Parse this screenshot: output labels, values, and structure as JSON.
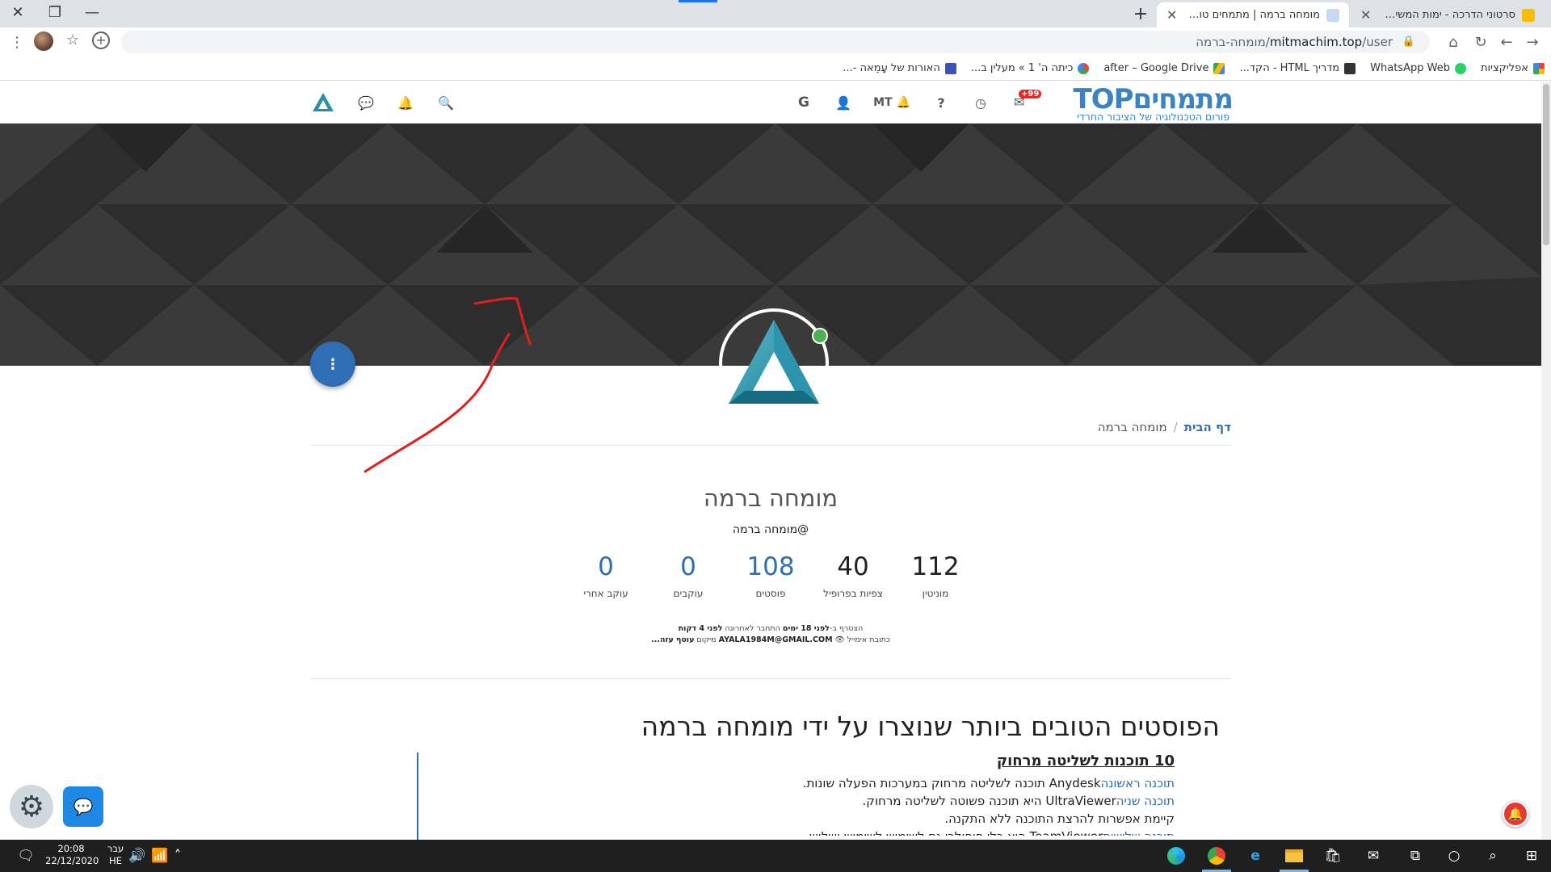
{
  "browser": {
    "tabs": [
      {
        "title": "סרטוני הדרכה - ימות המשיח – ve",
        "active": false
      },
      {
        "title": "מומחה ברמה | מתמחים טופ - פור",
        "active": true
      }
    ],
    "address": {
      "host": "mitmachim.top",
      "path": "/user/מומחה-ברמה"
    },
    "bookmarks": [
      {
        "label": "אפליקציות",
        "color": "#ea4335"
      },
      {
        "label": "WhatsApp Web",
        "color": "#25d366"
      },
      {
        "label": "מדריך HTML - הקד...",
        "color": "#333333"
      },
      {
        "label": "after – Google Drive",
        "color": "#fbbc04"
      },
      {
        "label": "כיתה ה' 1 » מעלין ב...",
        "color": "#34a853"
      },
      {
        "label": "האורות של עָמֵאה -...",
        "color": "#3f51b5"
      }
    ]
  },
  "site": {
    "logo_main": "מתמחיםTOP",
    "logo_sub": "פורום הטכנולוגיה של הציבור החרדי",
    "notif_badge": "+99",
    "header_user": "MT"
  },
  "breadcrumb": {
    "home": "דף הבית",
    "current": "מומחה ברמה",
    "sep": "/"
  },
  "profile": {
    "name": "מומחה ברמה",
    "handle": "@מומחה ברמה",
    "stats": [
      {
        "value": "112",
        "label": "מוניטין",
        "style": "dark"
      },
      {
        "value": "40",
        "label": "צפיות בפרופיל",
        "style": "dark"
      },
      {
        "value": "108",
        "label": "פוסטים",
        "style": "blue"
      },
      {
        "value": "0",
        "label": "עוקבים",
        "style": "blue"
      },
      {
        "value": "0",
        "label": "עוקב אחרי",
        "style": "blue"
      }
    ],
    "meta_line1_a": "הצטרף ב-",
    "meta_line1_b": "לפני 18 ימים",
    "meta_line1_c": " התחבר לאחרונה ",
    "meta_line1_d": "לפני 4 דקות",
    "meta_line2_a": "כתובת אימייל ",
    "meta_line2_b": "AYALA1984M@GMAIL.COM",
    "meta_line2_c": " מיקום ",
    "meta_line2_d": "עוטף עזה..."
  },
  "best_posts": {
    "heading": "הפוסטים הטובים ביותר שנוצרו על ידי מומחה ברמה",
    "post_title": "10 תוכנות לשליטה מרחוק",
    "lines": [
      {
        "link": "תוכנה ראשונה",
        "text": "Anydesk תוכנה לשליטה מרחוק במערכות הפעלה שונות."
      },
      {
        "link": "תוכנה שניה",
        "text": "UltraViewer היא תוכנה פשוטה לשליטה מרחוק."
      },
      {
        "link": "",
        "text": "קיימת אפשרות להרצת התוכנה ללא התקנה."
      },
      {
        "link": "תוכנה שלישית",
        "text": "TeamViewer היא כלי פופולרי גם לשימוש לשימוש ושלוש..."
      }
    ]
  },
  "taskbar": {
    "time": "20:08",
    "date": "22/12/2020",
    "lang_top": "עבר",
    "lang_bottom": "HE"
  }
}
